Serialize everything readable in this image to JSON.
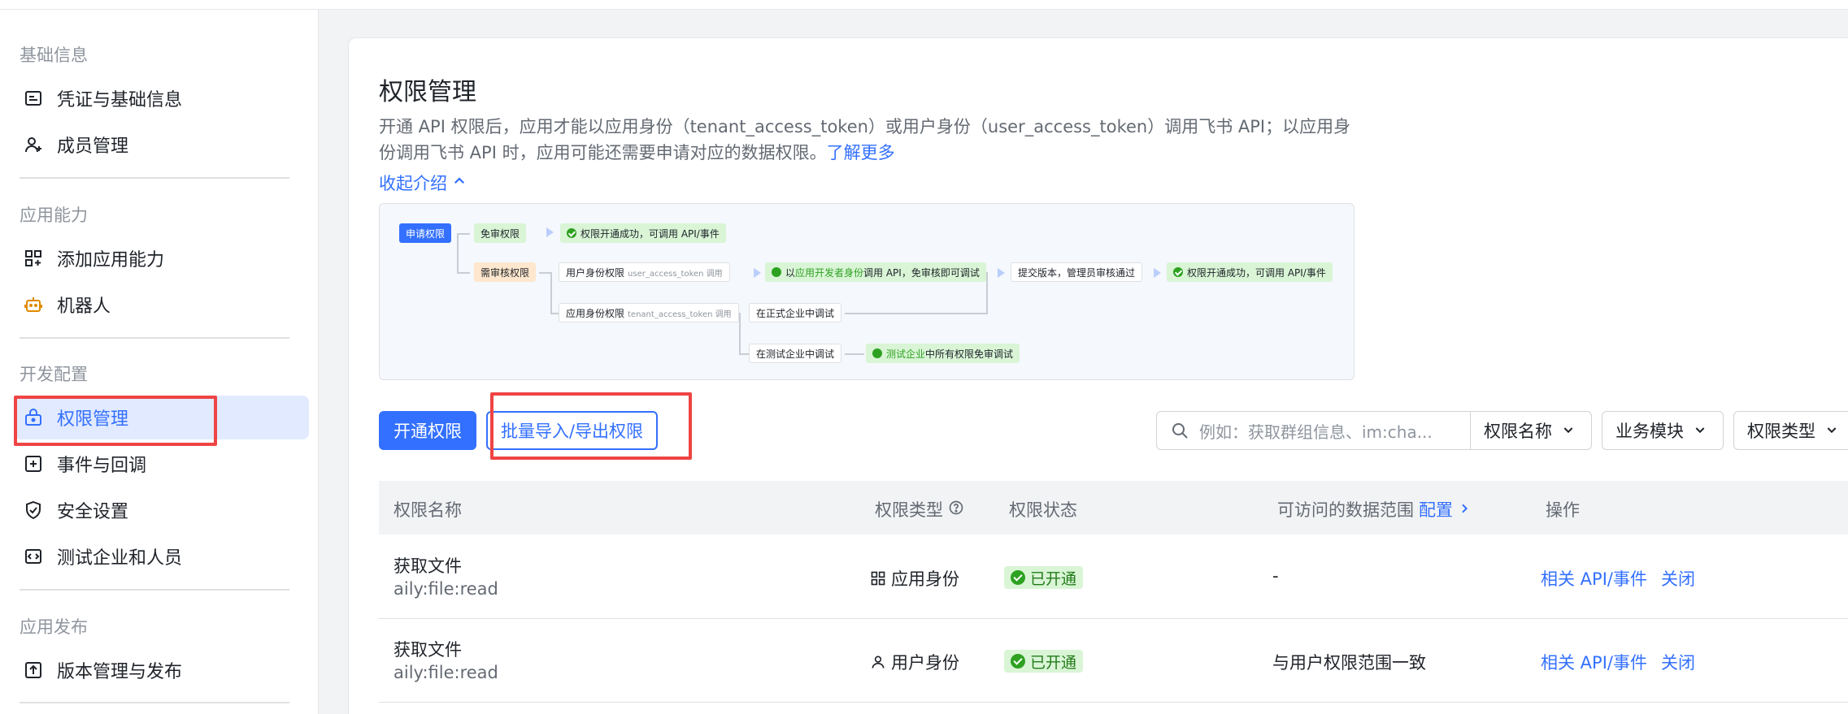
{
  "sidebar": {
    "sections": [
      {
        "title": "基础信息",
        "items": [
          {
            "label": "凭证与基础信息",
            "icon": "credential-icon"
          },
          {
            "label": "成员管理",
            "icon": "add-member-icon"
          }
        ]
      },
      {
        "title": "应用能力",
        "items": [
          {
            "label": "添加应用能力",
            "icon": "add-capability-icon"
          },
          {
            "label": "机器人",
            "icon": "robot-icon"
          }
        ]
      },
      {
        "title": "开发配置",
        "items": [
          {
            "label": "权限管理",
            "icon": "permission-icon",
            "active": true
          },
          {
            "label": "事件与回调",
            "icon": "event-icon"
          },
          {
            "label": "安全设置",
            "icon": "shield-icon"
          },
          {
            "label": "测试企业和人员",
            "icon": "test-icon"
          }
        ]
      },
      {
        "title": "应用发布",
        "items": [
          {
            "label": "版本管理与发布",
            "icon": "upload-icon"
          }
        ]
      }
    ]
  },
  "main": {
    "title": "权限管理",
    "description": "开通 API 权限后，应用才能以应用身份（tenant_access_token）或用户身份（user_access_token）调用飞书 API；以应用身份调用飞书 API 时，应用可能还需要申请对应的数据权限。",
    "learn_more": "了解更多",
    "collapse": "收起介绍",
    "flow": {
      "apply": "申请权限",
      "no_review": "免审权限",
      "success": "权限开通成功，可调用 API/事件",
      "need_review": "需审核权限",
      "user_identity": "用户身份权限",
      "user_token_note": "user_access_token 调用",
      "dev_prefix": "以",
      "dev_highlight": "应用开发者身份",
      "dev_suffix": "调用 API，免审核即可调试",
      "submit": "提交版本，管理员审核通过",
      "success2": "权限开通成功，可调用 API/事件",
      "app_identity": "应用身份权限",
      "tenant_token_note": "tenant_access_token 调用",
      "formal_debug": "在正式企业中调试",
      "test_debug": "在测试企业中调试",
      "test_highlight": "测试企业",
      "test_suffix": "中所有权限免审调试"
    },
    "buttons": {
      "enable": "开通权限",
      "batch": "批量导入/导出权限"
    },
    "search_placeholder": "例如：获取群组信息、im:cha...",
    "filters": [
      "权限名称",
      "业务模块",
      "权限类型"
    ],
    "table": {
      "headers": {
        "name": "权限名称",
        "type": "权限类型",
        "status": "权限状态",
        "scope": "可访问的数据范围",
        "scope_link": "配置",
        "ops": "操作"
      },
      "rows": [
        {
          "name": "获取文件",
          "code": "aily:file:read",
          "type": "应用身份",
          "type_icon": "grid-icon",
          "status": "已开通",
          "scope": "-",
          "op1": "相关 API/事件",
          "op2": "关闭"
        },
        {
          "name": "获取文件",
          "code": "aily:file:read",
          "type": "用户身份",
          "type_icon": "user-icon",
          "status": "已开通",
          "scope": "与用户权限范围一致",
          "op1": "相关 API/事件",
          "op2": "关闭"
        }
      ]
    }
  }
}
